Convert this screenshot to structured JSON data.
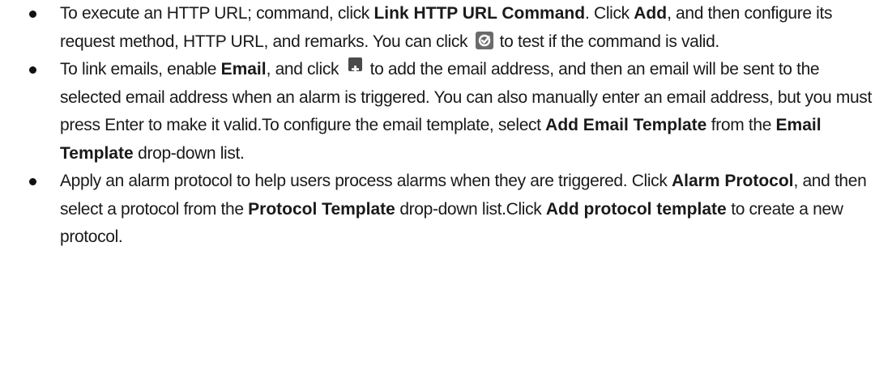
{
  "items": [
    {
      "t1": "To execute an HTTP URL; command, click ",
      "b1": "Link HTTP URL Command",
      "t2": ". Click ",
      "b2": "Add",
      "t3": ", and then configure its request method, HTTP URL, and remarks. You can click",
      "t4": "to test if the command is valid.",
      "icon": "test-icon"
    },
    {
      "t1": "To link emails, enable ",
      "b1": "Email",
      "t2": ", and click",
      "t3": "to add the email address, and then an email will be sent to the selected email address when an alarm is triggered. You can also manually enter an email address, but you must press Enter to make it valid.To configure the email template, select ",
      "b2": "Add Email Template",
      "t4": " from the ",
      "b3": "Email Template",
      "t5": "drop-down list.",
      "icon": "plus-icon"
    },
    {
      "t1": "Apply an alarm protocol to help users process alarms when they are triggered. Click ",
      "b1": "Alarm Protocol",
      "t2": ", and then select a protocol from the ",
      "b2": "Protocol Template",
      "t3": "drop-down list.Click ",
      "b3": "Add protocol template",
      "t4": "to create a new protocol."
    }
  ]
}
